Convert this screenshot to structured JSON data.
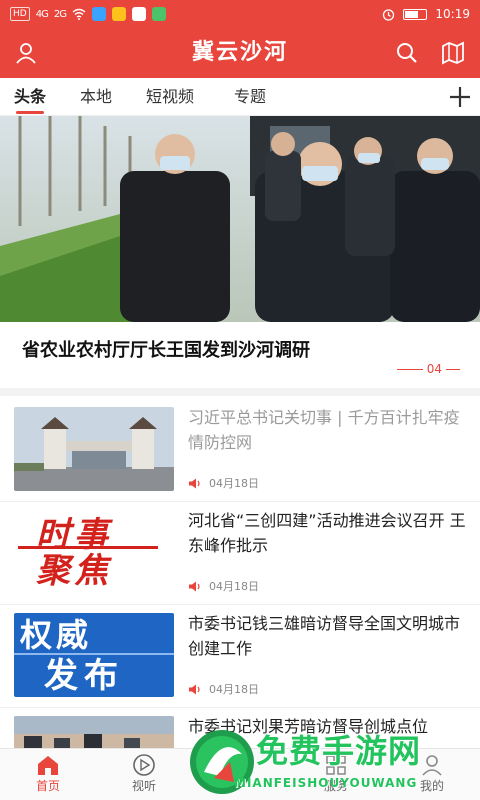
{
  "status_bar": {
    "time": "10:19",
    "network_chip": "HD",
    "signal1": "4G",
    "signal2": "2G"
  },
  "header": {
    "title": "冀云沙河"
  },
  "tabs": [
    {
      "label": "头条",
      "active": true
    },
    {
      "label": "本地",
      "active": false
    },
    {
      "label": "短视频",
      "active": false
    },
    {
      "label": "专题",
      "active": false
    }
  ],
  "hero": {
    "title": "省农业农村厅厅长王国发到沙河调研",
    "page_indicator": "04"
  },
  "news": [
    {
      "title": "习近平总书记关切事 | 千方百计扎牢疫情防控网",
      "date": "04月18日",
      "read": true,
      "thumb_icon": "gate-photo"
    },
    {
      "title": "河北省“三创四建”活动推进会议召开 王东峰作批示",
      "date": "04月18日",
      "read": false,
      "thumb_icon": "shishi-jujiao-banner"
    },
    {
      "title": "市委书记钱三雄暗访督导全国文明城市创建工作",
      "date": "04月18日",
      "read": false,
      "thumb_icon": "quanwei-fabu-banner"
    },
    {
      "title": "市委书记刘果芳暗访督导创城点位",
      "date": "",
      "read": false,
      "thumb_icon": "street-photo"
    }
  ],
  "thumb_text": {
    "shishi": "时事",
    "jujiao": "聚焦",
    "quanwei": "权威",
    "fabu": "发布"
  },
  "bottom_nav": [
    {
      "label": "首页",
      "icon": "home-icon",
      "active": true
    },
    {
      "label": "视听",
      "icon": "play-icon",
      "active": false
    },
    {
      "label": "服务",
      "icon": "grid-icon",
      "active": false
    },
    {
      "label": "我的",
      "icon": "user-icon",
      "active": false
    }
  ],
  "watermark": {
    "text": "免费手游网",
    "sub": "MIANFEISHOUYOUWANG"
  },
  "colors": {
    "brand_red": "#e8463d",
    "watermark_green": "#23c45e"
  }
}
